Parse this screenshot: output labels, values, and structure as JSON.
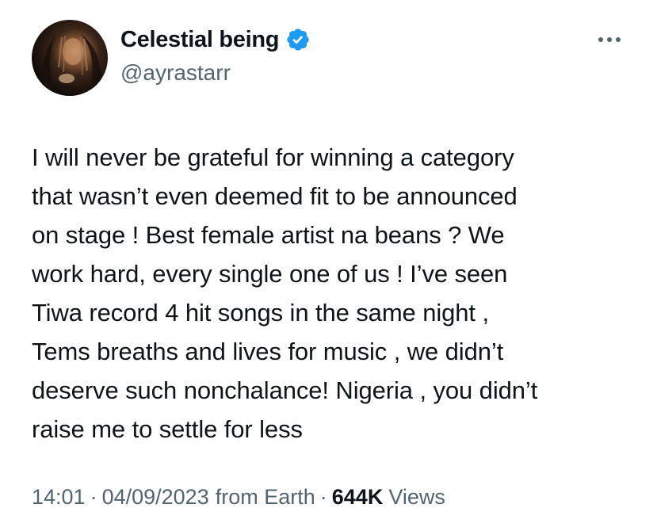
{
  "author": {
    "display_name": "Celestial being",
    "handle": "@ayrastarr",
    "verified": true
  },
  "icons": {
    "verified": "verified-badge-icon",
    "more": "more-options-icon"
  },
  "colors": {
    "verified_blue": "#1d9bf0",
    "text_primary": "#0f1419",
    "text_secondary": "#536471"
  },
  "tweet": {
    "text": "I will never be grateful for winning a category\nthat wasn’t even deemed fit to be announced\non stage ! Best female artist na beans ? We\nwork hard, every single one of us ! I’ve seen\nTiwa record 4 hit songs in the same night ,\nTems breaths and lives for music , we didn’t\ndeserve such nonchalance! Nigeria , you didn’t\nraise me to settle for less"
  },
  "meta": {
    "time": "14:01",
    "date": "04/09/2023",
    "source": "from Earth",
    "separator": "·",
    "views_count": "644K",
    "views_label": "Views"
  }
}
